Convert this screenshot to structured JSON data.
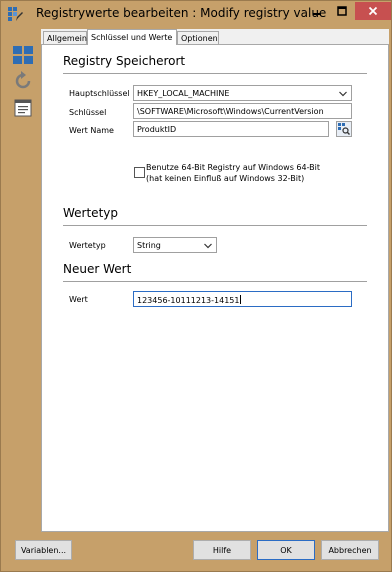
{
  "window": {
    "title": "Registrywerte bearbeiten : Modify registry value"
  },
  "icons": {
    "app": "registry-edit-icon",
    "toolbar": [
      "windows-grid-icon",
      "refresh-icon",
      "document-icon"
    ]
  },
  "tabs": [
    {
      "label": "Allgemein",
      "active": false
    },
    {
      "label": "Schlüssel und Werte",
      "active": true
    },
    {
      "label": "Optionen",
      "active": false
    }
  ],
  "registry_location": {
    "title": "Registry Speicherort",
    "hive_label": "Hauptschlüssel",
    "hive_value": "HKEY_LOCAL_MACHINE",
    "key_label": "Schlüssel",
    "key_value": "\\SOFTWARE\\Microsoft\\Windows\\CurrentVersion",
    "value_name_label": "Wert Name",
    "value_name_value": "ProduktID",
    "use64_line1": "Benutze 64-Bit Registry auf Windows 64-Bit",
    "use64_line2": "(hat keinen Einfluß auf Windows 32-Bit)",
    "use64_checked": false
  },
  "value_type": {
    "title": "Wertetyp",
    "label": "Wertetyp",
    "value": "String"
  },
  "new_value": {
    "title": "Neuer Wert",
    "label": "Wert",
    "value": "123456-10111213-14151"
  },
  "buttons": {
    "variables": "Variablen...",
    "help": "Hilfe",
    "ok": "OK",
    "cancel": "Abbrechen"
  },
  "colors": {
    "frame": "#c6a06a",
    "close": "#c75050",
    "focus": "#2b6cc4",
    "toolbar_blue": "#2e6db4"
  }
}
